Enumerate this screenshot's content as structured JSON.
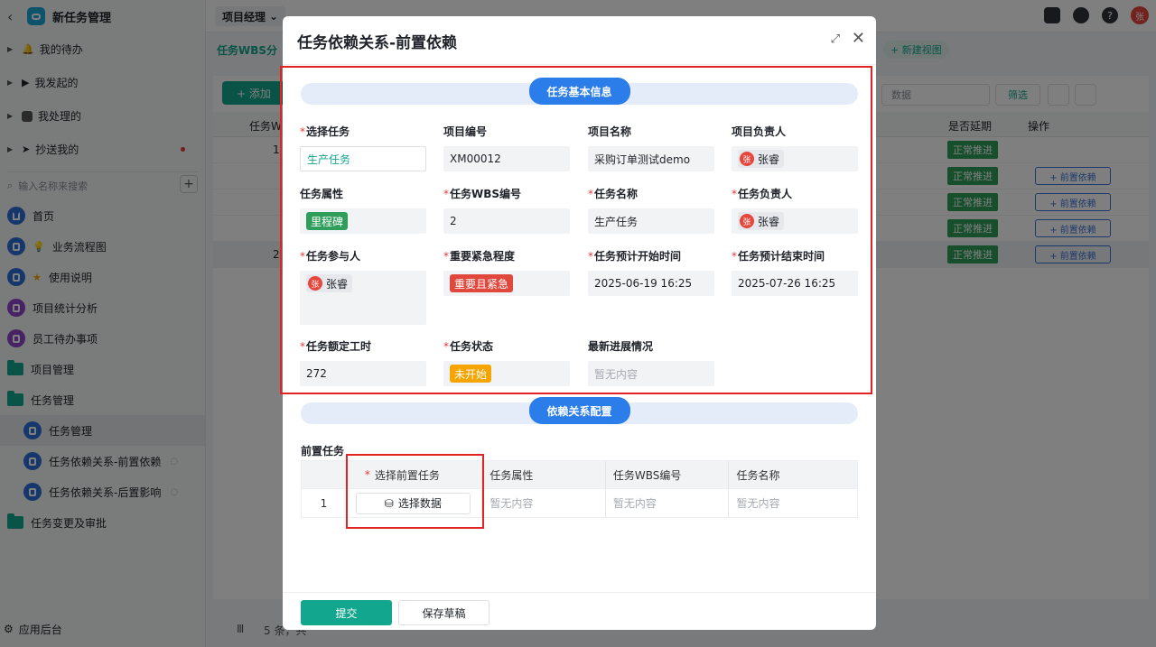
{
  "sidebar": {
    "app_title": "新任务管理",
    "groups": [
      {
        "label": "我的待办",
        "has_dot": false
      },
      {
        "label": "我发起的",
        "has_dot": false
      },
      {
        "label": "我处理的",
        "has_dot": false
      },
      {
        "label": "抄送我的",
        "has_dot": true
      }
    ],
    "search_placeholder": "输入名称来搜索",
    "nav": [
      {
        "label": "首页"
      },
      {
        "label": "业务流程图"
      },
      {
        "label": "使用说明"
      },
      {
        "label": "项目统计分析"
      },
      {
        "label": "员工待办事项"
      },
      {
        "label": "项目管理"
      },
      {
        "label": "任务管理"
      },
      {
        "label": "任务管理"
      },
      {
        "label": "任务依赖关系-前置依赖"
      },
      {
        "label": "任务依赖关系-后置影响"
      },
      {
        "label": "任务变更及审批"
      }
    ],
    "footer": "应用后台"
  },
  "topbar": {
    "role": "项目经理",
    "avatar": "张"
  },
  "background": {
    "tab": "任务WBS分",
    "new_view": "+ 新建视图",
    "add_button": "+ 添加",
    "select_placeholder": "数据",
    "filter": "筛选",
    "col_wbs": "任务W",
    "col_delay": "是否延期",
    "col_action": "操作",
    "row_status": "正常推进",
    "row_action": "+ 前置依赖",
    "row_num_1": "1",
    "row_num_2": "2",
    "footer_count": "5 条，共",
    "pagination_icon": "Ⅲ"
  },
  "modal": {
    "title": "任务依赖关系-前置依赖",
    "section_basic": "任务基本信息",
    "section_dep": "依赖关系配置",
    "fields": {
      "select_task": {
        "label": "选择任务",
        "value": "生产任务"
      },
      "project_code": {
        "label": "项目编号",
        "value": "XM00012"
      },
      "project_name": {
        "label": "项目名称",
        "value": "采购订单测试demo"
      },
      "project_owner": {
        "label": "项目负责人",
        "value": "张睿",
        "avatar": "张"
      },
      "task_attr": {
        "label": "任务属性",
        "value": "里程碑"
      },
      "wbs_code": {
        "label": "任务WBS编号",
        "value": "2"
      },
      "task_name": {
        "label": "任务名称",
        "value": "生产任务"
      },
      "task_owner": {
        "label": "任务负责人",
        "value": "张睿",
        "avatar": "张"
      },
      "participants": {
        "label": "任务参与人",
        "value": "张睿",
        "avatar": "张"
      },
      "priority": {
        "label": "重要紧急程度",
        "value": "重要且紧急"
      },
      "start_time": {
        "label": "任务预计开始时间",
        "value": "2025-06-19 16:25"
      },
      "end_time": {
        "label": "任务预计结束时间",
        "value": "2025-07-26 16:25"
      },
      "work_hours": {
        "label": "任务额定工时",
        "value": "272"
      },
      "status": {
        "label": "任务状态",
        "value": "未开始"
      },
      "progress": {
        "label": "最新进展情况",
        "value": "暂无内容"
      }
    },
    "dependency": {
      "label": "前置任务",
      "headers": [
        "选择前置任务",
        "任务属性",
        "任务WBS编号",
        "任务名称"
      ],
      "row": {
        "index": "1",
        "button": "选择数据",
        "attr": "暂无内容",
        "wbs": "暂无内容",
        "name": "暂无内容"
      }
    },
    "footer": {
      "submit": "提交",
      "draft": "保存草稿"
    }
  },
  "colors": {
    "brand": "#12a68e",
    "section_blue": "#2b7de9",
    "milestone_tag": "#2f9e5b",
    "urgent_tag": "#e0483e",
    "not_started_tag": "#f5a400",
    "highlight_box": "#e02424"
  }
}
